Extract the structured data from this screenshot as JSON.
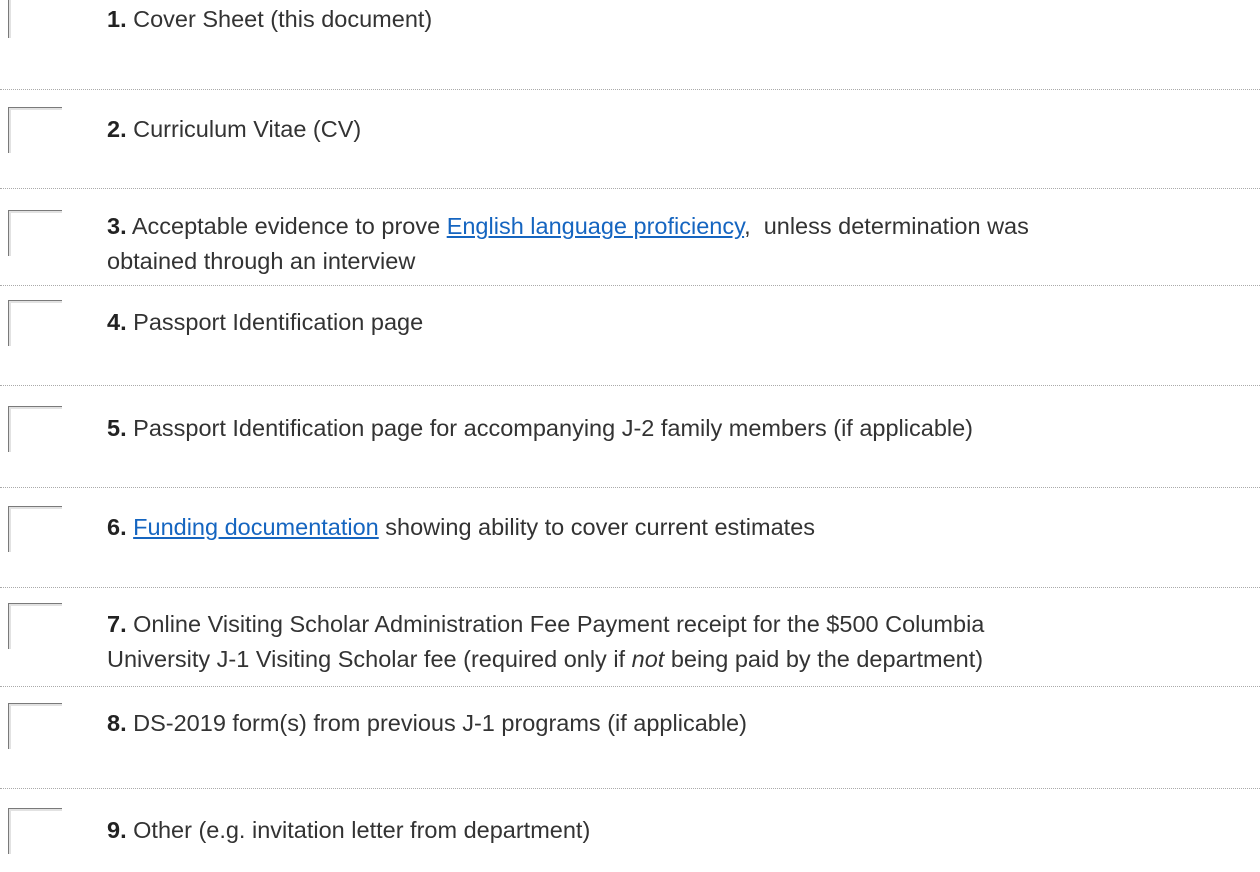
{
  "checklist": {
    "items": [
      {
        "number": "1.",
        "text": "Cover Sheet (this document)"
      },
      {
        "number": "2.",
        "text": "Curriculum Vitae (CV)"
      },
      {
        "number": "3.",
        "before": "Acceptable evidence to prove ",
        "link": "English language proficiency",
        "after": ",  unless determination was",
        "line2": "obtained through an interview"
      },
      {
        "number": "4.",
        "text": "Passport Identification page"
      },
      {
        "number": "5.",
        "text": "Passport Identification page for accompanying J-2 family members (if applicable)"
      },
      {
        "number": "6.",
        "link": "Funding documentation",
        "after": " showing ability to cover current estimates"
      },
      {
        "number": "7.",
        "text": "Online Visiting Scholar Administration Fee Payment receipt for the $500 Columbia",
        "line2_before": "University J-1 Visiting Scholar fee (required only if ",
        "line2_em": "not",
        "line2_after": " being paid by the department)"
      },
      {
        "number": "8.",
        "text": "DS-2019 form(s) from previous J-1 programs (if applicable)"
      },
      {
        "number": "9.",
        "text": "Other (e.g. invitation letter from department)"
      }
    ]
  }
}
